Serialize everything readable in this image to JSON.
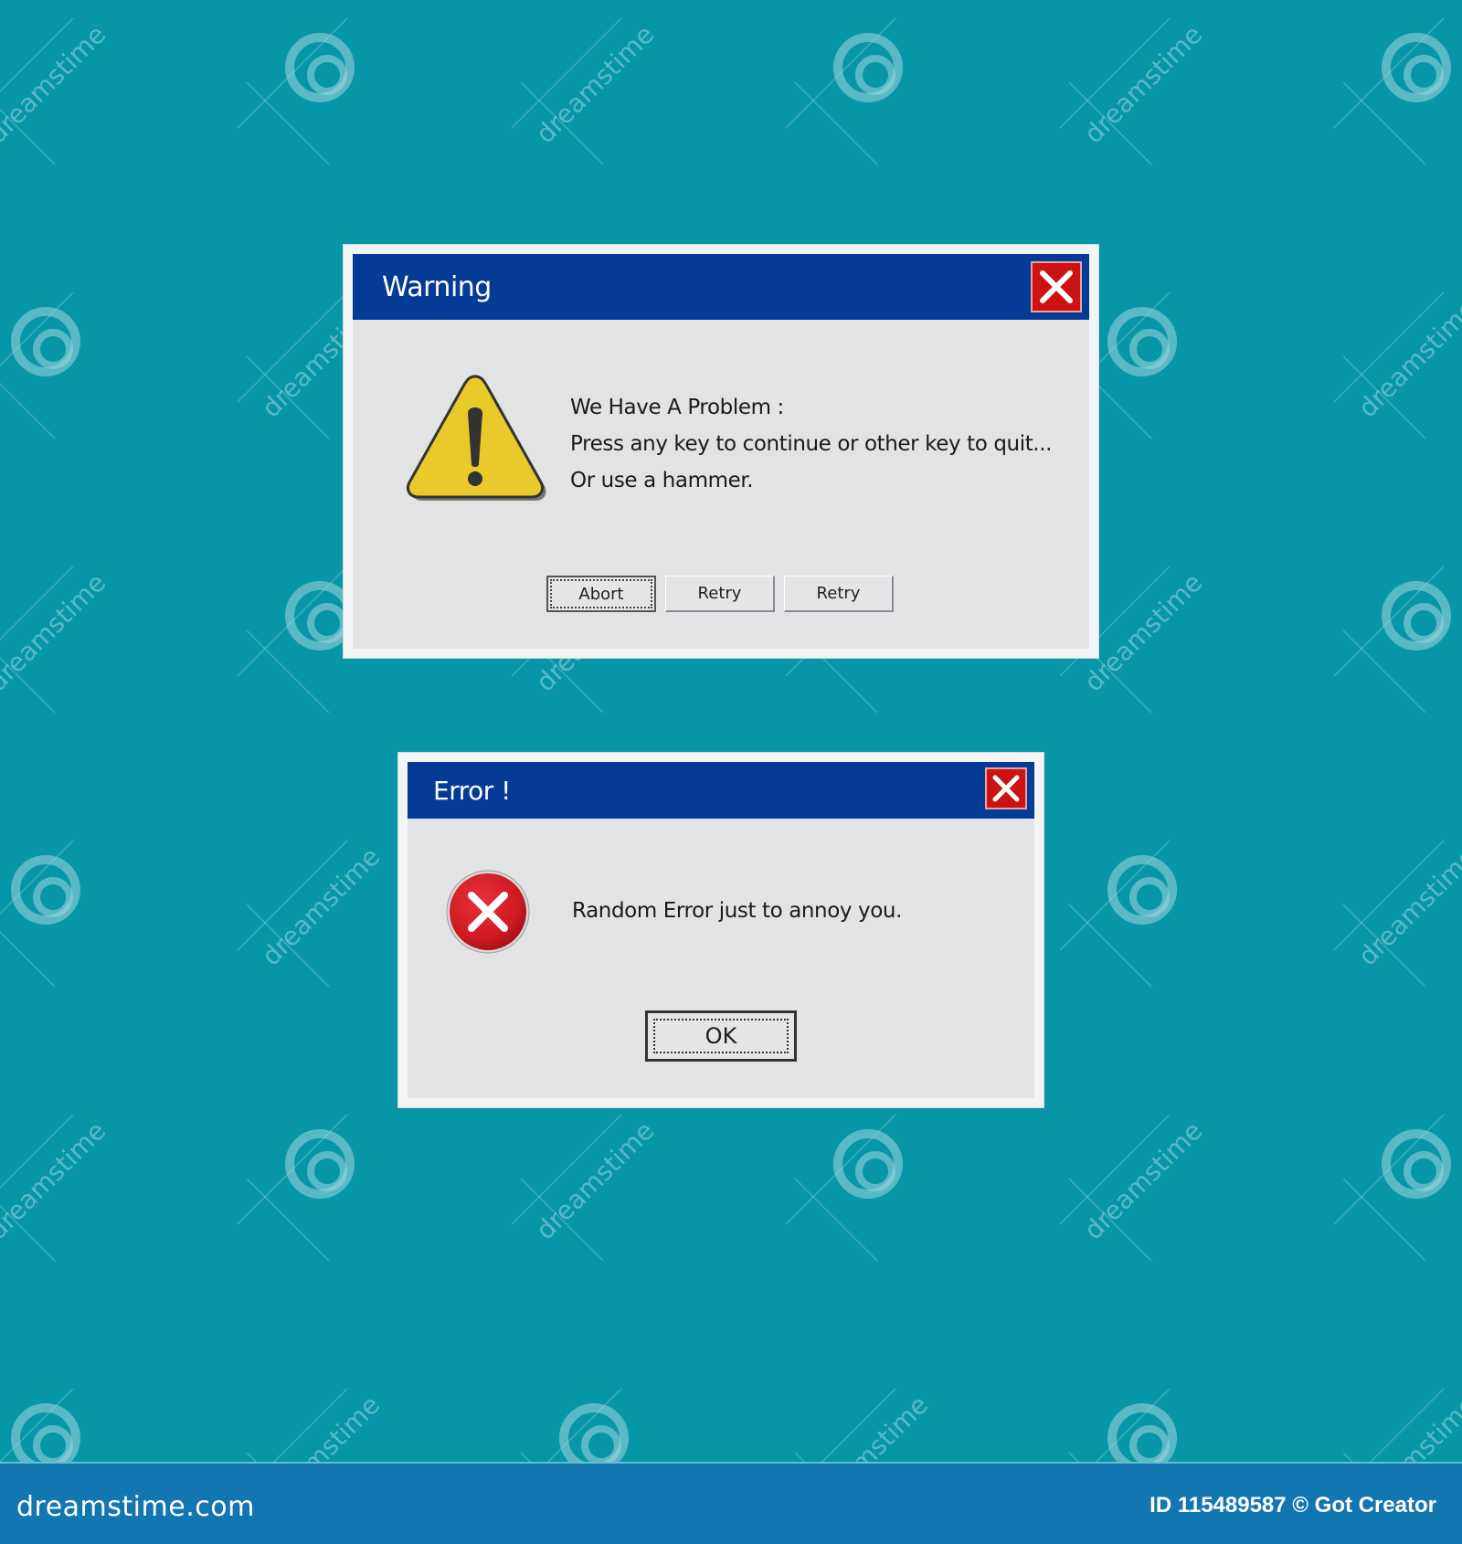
{
  "colors": {
    "background": "#0696a6",
    "titlebar": "#043b97",
    "close_button": "#cc1212",
    "dialog_body": "#e2e3e5",
    "warning_yellow": "#e8cb2a",
    "error_red": "#d01a24",
    "footer": "#1276b0"
  },
  "warning_dialog": {
    "title": "Warning",
    "icon": "warning-triangle-icon",
    "close_icon": "close-icon",
    "message_lines": [
      "We Have A Problem :",
      "Press any key to continue or other key to quit...",
      "Or use a hammer."
    ],
    "buttons": [
      {
        "label": "Abort",
        "focused": true
      },
      {
        "label": "Retry",
        "focused": false
      },
      {
        "label": "Retry",
        "focused": false
      }
    ]
  },
  "error_dialog": {
    "title": "Error !",
    "icon": "error-circle-icon",
    "close_icon": "close-icon",
    "message": "Random Error just to annoy you.",
    "ok_label": "OK"
  },
  "watermark": {
    "text": "dreamstime"
  },
  "footer": {
    "logo": "dreamstime.com",
    "credit": "ID 115489587 © Got Creator"
  }
}
